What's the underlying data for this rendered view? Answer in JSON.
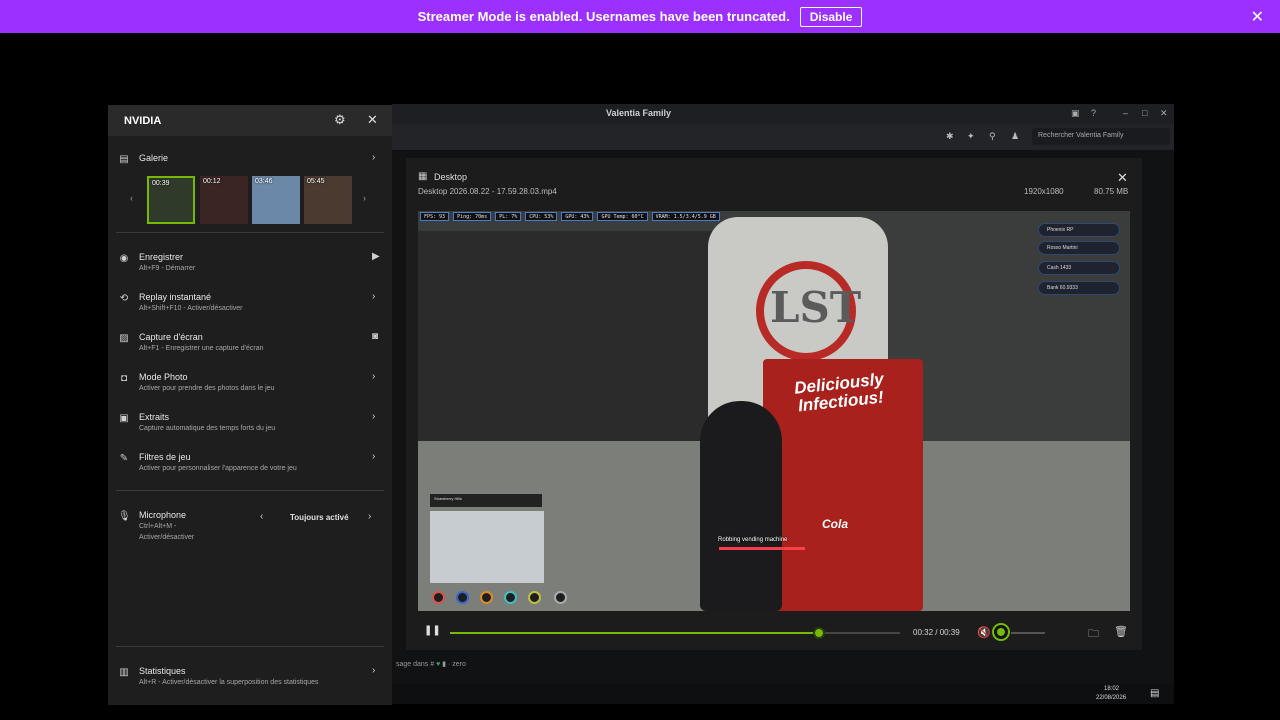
{
  "banner": {
    "message": "Streamer Mode is enabled. Usernames have been truncated.",
    "disable_label": "Disable"
  },
  "discord": {
    "title": "Valentia Family",
    "search_placeholder": "Rechercher Valentia Family",
    "chat_preview": "sage dans #",
    "chat_preview_tail": "· zero",
    "taskbar_time": "18:02",
    "taskbar_date": "22/08/2026"
  },
  "nvidia": {
    "title": "NVIDIA",
    "gallery": {
      "label": "Galerie",
      "thumbnails": [
        {
          "duration": "00:39",
          "selected": true,
          "color": "#2f3a2a"
        },
        {
          "duration": "00:12",
          "selected": false,
          "color": "#3a2424"
        },
        {
          "duration": "03:46",
          "selected": false,
          "color": "#6c88a8"
        },
        {
          "duration": "05:45",
          "selected": false,
          "color": "#4a3a30"
        }
      ]
    },
    "items": [
      {
        "label": "Enregistrer",
        "sub": "Alt+F9 - Démarrer",
        "icon": "record-icon",
        "arrow": "▶"
      },
      {
        "label": "Replay instantané",
        "sub": "Alt+Shift+F10 - Activer/désactiver",
        "icon": "replay-icon",
        "arrow": "›"
      },
      {
        "label": "Capture d'écran",
        "sub": "Alt+F1 - Enregistrer une capture d'écran",
        "icon": "screenshot-icon",
        "arrow": "📷"
      },
      {
        "label": "Mode Photo",
        "sub": "Activer pour prendre des photos dans le jeu",
        "icon": "camera-icon",
        "arrow": "›"
      },
      {
        "label": "Extraits",
        "sub": "Capture automatique des temps forts du jeu",
        "icon": "clips-icon",
        "arrow": "›"
      },
      {
        "label": "Filtres de jeu",
        "sub": "Activer pour personnaliser l'apparence de votre jeu",
        "icon": "filter-icon",
        "arrow": "›"
      }
    ],
    "microphone": {
      "label": "Microphone",
      "sub1": "Ctrl+Alt+M -",
      "sub2": "Activer/désactiver",
      "value": "Toujours activé"
    },
    "stats": {
      "label": "Statistiques",
      "sub": "Alt+R - Activer/désactiver la superposition des statistiques"
    }
  },
  "player": {
    "source": "Desktop",
    "filename": "Desktop 2026.08.22 - 17.59.28.03.mp4",
    "resolution": "1920x1080",
    "size": "80.75 MB",
    "time": "00:32 / 00:39",
    "progress": 0.82,
    "volume": 0.0,
    "accent": "#76b900"
  },
  "game": {
    "stats_bar": [
      "FPS: 93",
      "Ping: 70ms",
      "PL: 7%",
      "CPU: 53%",
      "GPU: 43%",
      "GPU Temp: 60°C",
      "VRAM: 1.5/3.4/5.9 GB"
    ],
    "machine_title": "Deliciously Infectious!",
    "machine_brand": "Cola",
    "action_label": "Robbing vending machine",
    "hud": [
      "Phoenix RP",
      "Rosso Martini",
      "Cash 1433",
      "Bank 60.9333"
    ],
    "location": "Strawberry Hills"
  }
}
